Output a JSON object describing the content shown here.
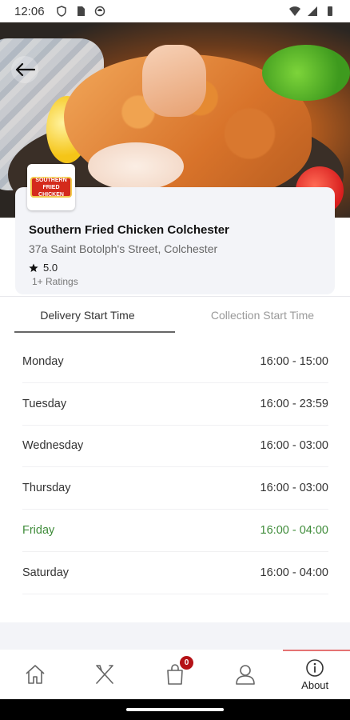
{
  "status_bar": {
    "time": "12:06",
    "left_icons": [
      "shield-icon",
      "sim-icon",
      "sync-icon"
    ],
    "right_icons": [
      "wifi-icon",
      "signal-icon",
      "battery-icon"
    ]
  },
  "restaurant": {
    "logo_text_line1": "SOUTHERN",
    "logo_text_line2": "FRIED CHICKEN",
    "name": "Southern Fried Chicken Colchester",
    "address": "37a Saint Botolph's Street, Colchester",
    "rating": "5.0",
    "ratings_count": "1+ Ratings"
  },
  "tabs": [
    {
      "label": "Delivery Start Time",
      "active": true
    },
    {
      "label": "Collection Start Time",
      "active": false
    }
  ],
  "schedule": [
    {
      "day": "Monday",
      "hours": "16:00 - 15:00"
    },
    {
      "day": "Tuesday",
      "hours": "16:00 - 23:59"
    },
    {
      "day": "Wednesday",
      "hours": "16:00 - 03:00"
    },
    {
      "day": "Thursday",
      "hours": "16:00 - 03:00"
    },
    {
      "day": "Friday",
      "hours": "16:00 - 04:00",
      "today": true
    },
    {
      "day": "Saturday",
      "hours": "16:00 - 04:00"
    }
  ],
  "colors": {
    "today_accent": "#3f8c3a",
    "badge": "#b51217",
    "active_indicator": "#e57373"
  },
  "bottom_nav": {
    "items": [
      {
        "icon": "home-icon"
      },
      {
        "icon": "fork-knife-icon"
      },
      {
        "icon": "shopping-bag-icon",
        "badge": "0"
      },
      {
        "icon": "profile-icon"
      },
      {
        "icon": "info-icon",
        "label": "About",
        "active": true
      }
    ]
  }
}
